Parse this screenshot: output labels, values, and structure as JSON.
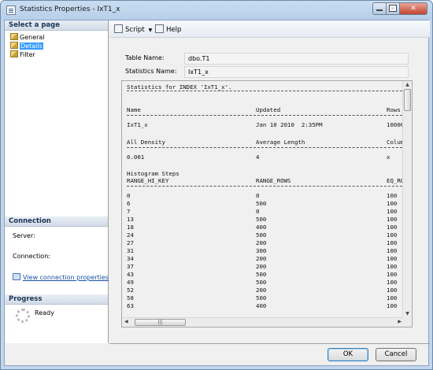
{
  "window": {
    "title": "Statistics Properties - IxT1_x"
  },
  "sidebar": {
    "select_page_header": "Select a page",
    "pages": [
      {
        "label": "General",
        "selected": false
      },
      {
        "label": "Details",
        "selected": true
      },
      {
        "label": "Filter",
        "selected": false
      }
    ],
    "connection_header": "Connection",
    "server_label": "Server:",
    "connection_label": "Connection:",
    "view_connection_link": "View connection properties",
    "progress_header": "Progress",
    "progress_status": "Ready"
  },
  "toolbar": {
    "script_label": "Script",
    "help_label": "Help"
  },
  "form": {
    "table_name_label": "Table Name:",
    "table_name_value": "dbo.T1",
    "statistics_name_label": "Statistics Name:",
    "statistics_name_value": "IxT1_x"
  },
  "stats": {
    "header_line": "Statistics for INDEX 'IxT1_x'.",
    "columns1": {
      "name": "Name",
      "updated": "Updated",
      "rows": "Rows"
    },
    "row1": {
      "name": "IxT1_x",
      "updated": "Jan 10 2010  2:35PM",
      "rows": "10000"
    },
    "columns2": {
      "density": "All Density",
      "avglen": "Average Length",
      "column": "Colum"
    },
    "row2": {
      "density": "0.001",
      "avglen": "4",
      "column": "x"
    },
    "histogram_title": "Histogram Steps",
    "hist_columns": {
      "hi_key": "RANGE_HI_KEY",
      "range_rows": "RANGE_ROWS",
      "eq_rows": "EQ_RO"
    },
    "histogram": [
      [
        "0",
        "0",
        "100"
      ],
      [
        "6",
        "500",
        "100"
      ],
      [
        "7",
        "0",
        "100"
      ],
      [
        "13",
        "500",
        "100"
      ],
      [
        "18",
        "400",
        "100"
      ],
      [
        "24",
        "500",
        "100"
      ],
      [
        "27",
        "200",
        "100"
      ],
      [
        "31",
        "300",
        "100"
      ],
      [
        "34",
        "200",
        "100"
      ],
      [
        "37",
        "200",
        "100"
      ],
      [
        "43",
        "500",
        "100"
      ],
      [
        "49",
        "500",
        "100"
      ],
      [
        "52",
        "200",
        "100"
      ],
      [
        "58",
        "500",
        "100"
      ],
      [
        "63",
        "400",
        "100"
      ]
    ]
  },
  "buttons": {
    "ok_label": "OK",
    "cancel_label": "Cancel"
  }
}
